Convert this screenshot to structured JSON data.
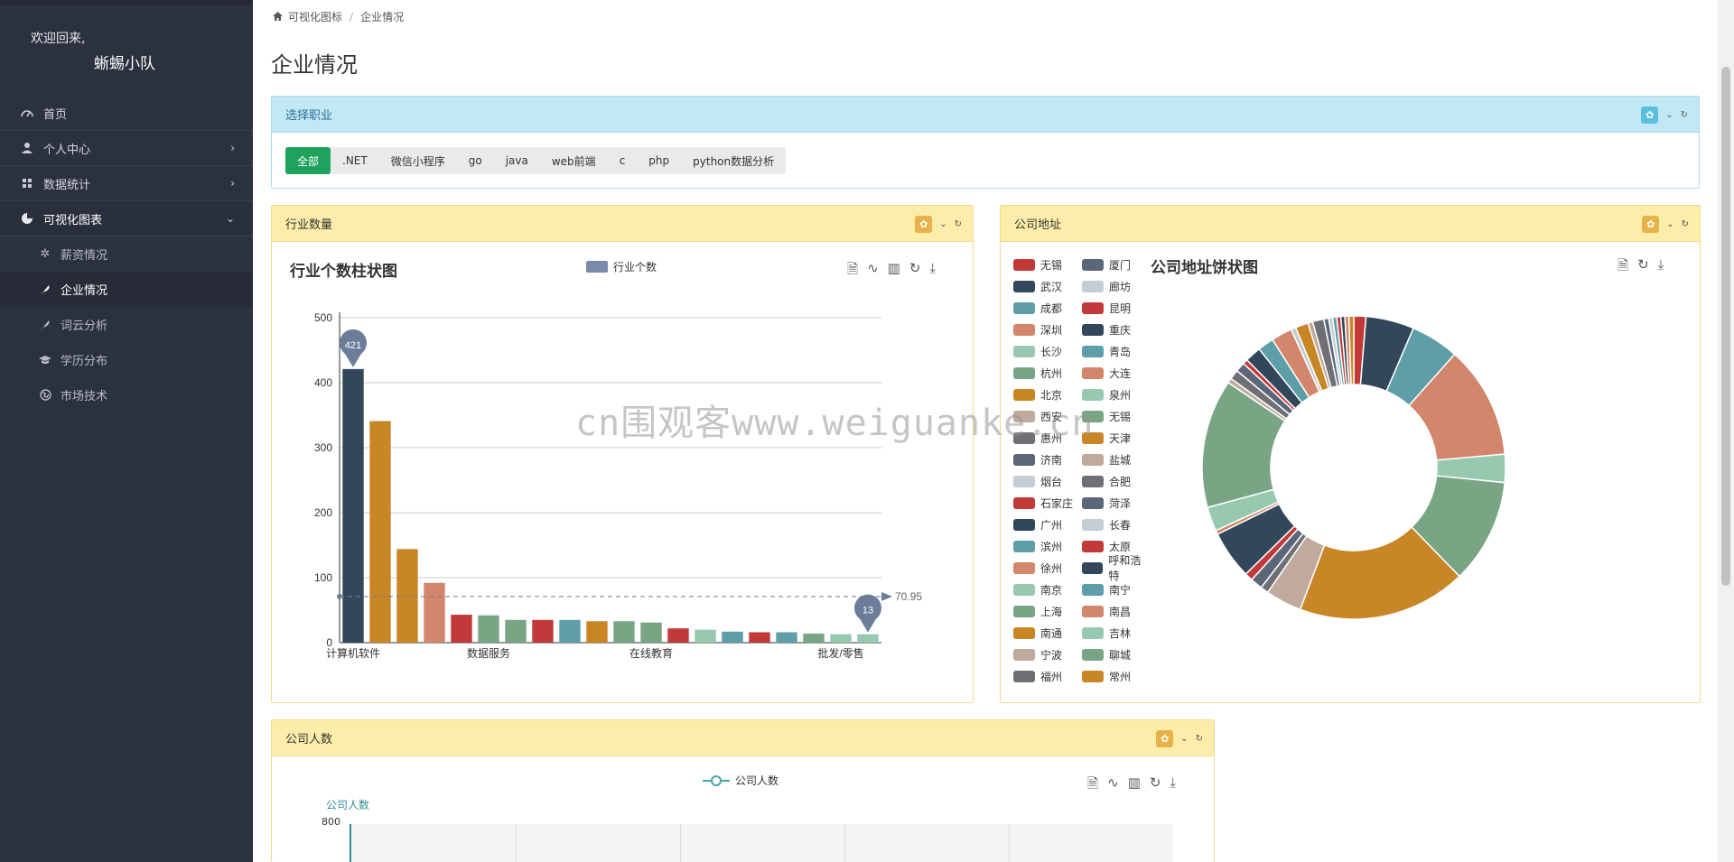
{
  "sidebar": {
    "welcome": "欢迎回来,",
    "username": "蜥蜴小队",
    "items": [
      {
        "label": "首页",
        "icon": "dashboard-icon"
      },
      {
        "label": "个人中心",
        "icon": "user-icon"
      },
      {
        "label": "数据统计",
        "icon": "grid-icon"
      },
      {
        "label": "可视化图表",
        "icon": "pie-icon"
      }
    ],
    "subitems": [
      {
        "label": "薪资情况",
        "icon": "star-icon"
      },
      {
        "label": "企业情况",
        "icon": "feather-icon"
      },
      {
        "label": "词云分析",
        "icon": "feather-icon"
      },
      {
        "label": "学历分布",
        "icon": "graduation-icon"
      },
      {
        "label": "市场技术",
        "icon": "globe-icon"
      }
    ]
  },
  "breadcrumb": {
    "home": "可视化图标",
    "current": "企业情况"
  },
  "page_title": "企业情况",
  "filter": {
    "title": "选择职业",
    "tags": [
      "全部",
      ".NET",
      "微信小程序",
      "go",
      "java",
      "web前端",
      "c",
      "php",
      "python数据分析"
    ]
  },
  "industry_panel": {
    "title": "行业数量",
    "chart_title": "行业个数柱状图",
    "legend": "行业个数",
    "max_label": "421",
    "min_label": "13",
    "avg_label": "70.95"
  },
  "address_panel": {
    "title": "公司地址",
    "chart_title": "公司地址饼状图"
  },
  "people_panel": {
    "title": "公司人数",
    "legend": "公司人数",
    "ylabel": "公司人数",
    "ytick": "800"
  },
  "watermark": "cn围观客www.weiguanke.cn",
  "chart_data": [
    {
      "type": "bar",
      "title": "行业个数柱状图",
      "categories": [
        "计算机软件",
        "",
        "",
        "",
        "",
        "数据服务",
        "",
        "",
        "",
        "",
        "",
        "在线教育",
        "",
        "",
        "",
        "",
        "",
        "",
        "批发/零售",
        ""
      ],
      "series": [
        {
          "name": "行业个数",
          "values": [
            421,
            341,
            144,
            92,
            43,
            42,
            35,
            35,
            35,
            33,
            33,
            31,
            22,
            20,
            17,
            16,
            16,
            14,
            13,
            13
          ]
        }
      ],
      "ylim": [
        0,
        500
      ],
      "yticks": [
        "0",
        "100",
        "200",
        "300",
        "400",
        "500"
      ],
      "colors": [
        "#33475b",
        "#c98626",
        "#c98626",
        "#d2866b",
        "#c2393a",
        "#7aa584",
        "#7aa584",
        "#c2393a",
        "#5e9ea8",
        "#c98626",
        "#7aa584",
        "#7aa584",
        "#c2393a",
        "#97c9b1",
        "#5e9ea8",
        "#c2393a",
        "#5e9ea8",
        "#7aa584",
        "#97c9b1",
        "#97c9b1"
      ],
      "markers": {
        "max": 421,
        "min": 13,
        "average": 70.95
      },
      "grid": true
    },
    {
      "type": "pie",
      "title": "公司地址饼状图",
      "legend": [
        {
          "name": "无锡",
          "color": "#c2393a"
        },
        {
          "name": "厦门",
          "color": "#5b6778"
        },
        {
          "name": "武汉",
          "color": "#33475b"
        },
        {
          "name": "廊坊",
          "color": "#c4ccd4"
        },
        {
          "name": "成都",
          "color": "#5e9ea8"
        },
        {
          "name": "昆明",
          "color": "#c2393a"
        },
        {
          "name": "深圳",
          "color": "#d2866b"
        },
        {
          "name": "重庆",
          "color": "#33475b"
        },
        {
          "name": "长沙",
          "color": "#97c9b1"
        },
        {
          "name": "青岛",
          "color": "#5e9ea8"
        },
        {
          "name": "杭州",
          "color": "#7aa584"
        },
        {
          "name": "大连",
          "color": "#d2866b"
        },
        {
          "name": "北京",
          "color": "#c98626"
        },
        {
          "name": "泉州",
          "color": "#97c9b1"
        },
        {
          "name": "西安",
          "color": "#c0aa9e"
        },
        {
          "name": "无锡",
          "color": "#7aa584"
        },
        {
          "name": "惠州",
          "color": "#6f7076"
        },
        {
          "name": "天津",
          "color": "#c98626"
        },
        {
          "name": "济南",
          "color": "#5b6778"
        },
        {
          "name": "盐城",
          "color": "#c0aa9e"
        },
        {
          "name": "烟台",
          "color": "#c4ccd4"
        },
        {
          "name": "合肥",
          "color": "#6f7076"
        },
        {
          "name": "石家庄",
          "color": "#c2393a"
        },
        {
          "name": "菏泽",
          "color": "#5b6778"
        },
        {
          "name": "广州",
          "color": "#33475b"
        },
        {
          "name": "长春",
          "color": "#c4ccd4"
        },
        {
          "name": "滨州",
          "color": "#5e9ea8"
        },
        {
          "name": "太原",
          "color": "#c2393a"
        },
        {
          "name": "徐州",
          "color": "#d2866b"
        },
        {
          "name": "呼和浩特",
          "color": "#33475b"
        },
        {
          "name": "南京",
          "color": "#97c9b1"
        },
        {
          "name": "南宁",
          "color": "#5e9ea8"
        },
        {
          "name": "上海",
          "color": "#7aa584"
        },
        {
          "name": "南昌",
          "color": "#d2866b"
        },
        {
          "name": "南通",
          "color": "#c98626"
        },
        {
          "name": "吉林",
          "color": "#97c9b1"
        },
        {
          "name": "宁波",
          "color": "#c0aa9e"
        },
        {
          "name": "聊城",
          "color": "#7aa584"
        },
        {
          "name": "福州",
          "color": "#6f7076"
        },
        {
          "name": "常州",
          "color": "#c98626"
        }
      ],
      "slices": [
        {
          "value": 1.5,
          "color": "#c2393a"
        },
        {
          "value": 6,
          "color": "#33475b"
        },
        {
          "value": 6,
          "color": "#5e9ea8"
        },
        {
          "value": 14,
          "color": "#d2866b"
        },
        {
          "value": 3.5,
          "color": "#97c9b1"
        },
        {
          "value": 13,
          "color": "#7aa584"
        },
        {
          "value": 21,
          "color": "#c98626"
        },
        {
          "value": 4.5,
          "color": "#c0aa9e"
        },
        {
          "value": 1,
          "color": "#6f7076"
        },
        {
          "value": 1.5,
          "color": "#5b6778"
        },
        {
          "value": 1,
          "color": "#c2393a"
        },
        {
          "value": 6,
          "color": "#33475b"
        },
        {
          "value": 0.5,
          "color": "#d2866b"
        },
        {
          "value": 3,
          "color": "#97c9b1"
        },
        {
          "value": 16,
          "color": "#7aa584"
        },
        {
          "value": 0.6,
          "color": "#c0aa9e"
        },
        {
          "value": 1.2,
          "color": "#6f7076"
        },
        {
          "value": 1.2,
          "color": "#5b6778"
        },
        {
          "value": 0.6,
          "color": "#c2393a"
        },
        {
          "value": 2,
          "color": "#33475b"
        },
        {
          "value": 2,
          "color": "#5e9ea8"
        },
        {
          "value": 2.6,
          "color": "#d2866b"
        },
        {
          "value": 0.6,
          "color": "#c4ccd4"
        },
        {
          "value": 1.6,
          "color": "#c98626"
        },
        {
          "value": 0.6,
          "color": "#c0aa9e"
        },
        {
          "value": 1.4,
          "color": "#6f7076"
        },
        {
          "value": 0.6,
          "color": "#5b6778"
        },
        {
          "value": 0.5,
          "color": "#c4ccd4"
        },
        {
          "value": 0.5,
          "color": "#5e9ea8"
        },
        {
          "value": 0.5,
          "color": "#c2393a"
        },
        {
          "value": 0.5,
          "color": "#33475b"
        },
        {
          "value": 0.5,
          "color": "#d2866b"
        },
        {
          "value": 0.6,
          "color": "#c98626"
        }
      ]
    },
    {
      "type": "line",
      "title": "",
      "ylabel": "公司人数",
      "series": [
        {
          "name": "公司人数",
          "values": []
        }
      ],
      "yticks": [
        "800"
      ]
    }
  ]
}
